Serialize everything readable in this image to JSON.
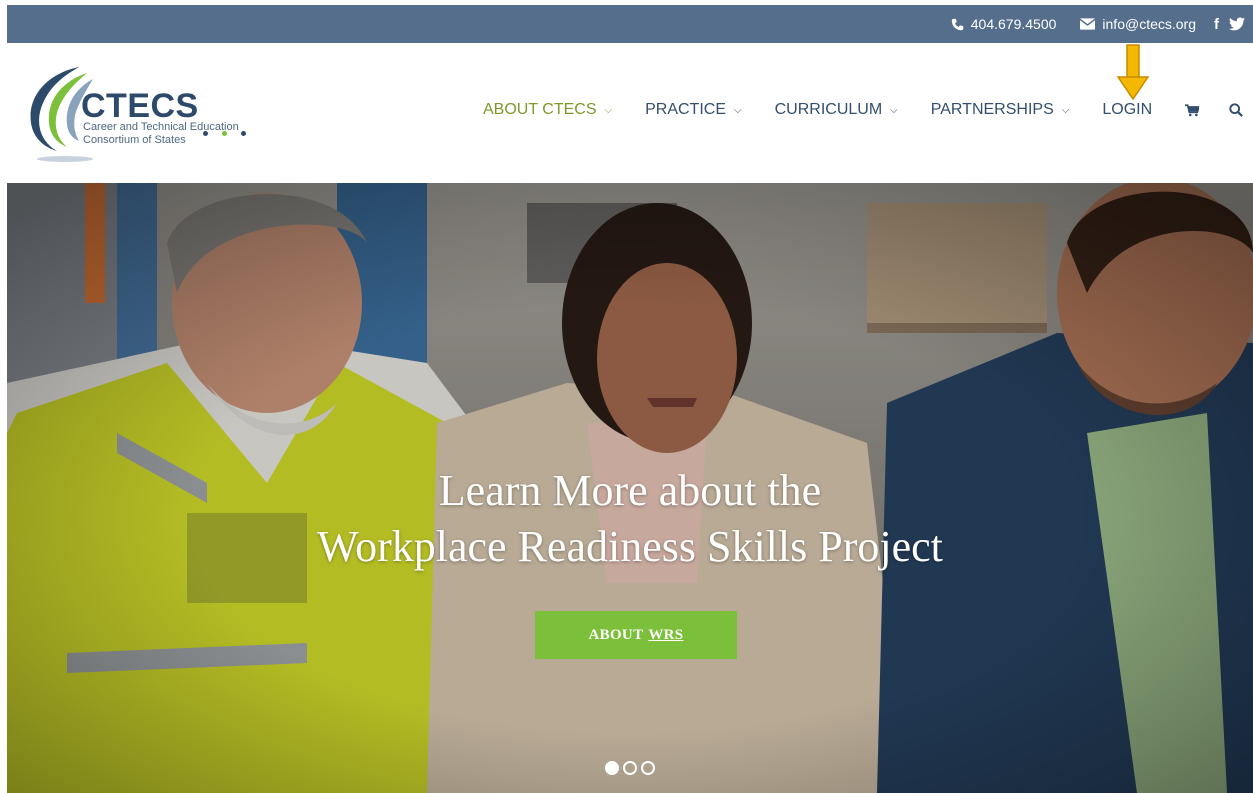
{
  "topbar": {
    "phone": "404.679.4500",
    "email": "info@ctecs.org",
    "social": [
      "facebook-icon",
      "twitter-icon"
    ]
  },
  "logo": {
    "brand": "CTECS",
    "tagline_line1": "Career and Technical Education",
    "tagline_line2": "Consortium of States",
    "dot_colors": [
      "#2e4a6b",
      "#7cbf3a",
      "#2e4a6b"
    ]
  },
  "nav": {
    "items": [
      {
        "label": "ABOUT CTECS",
        "dropdown": true,
        "active": true
      },
      {
        "label": "PRACTICE",
        "dropdown": true
      },
      {
        "label": "CURRICULUM",
        "dropdown": true
      },
      {
        "label": "PARTNERSHIPS",
        "dropdown": true
      },
      {
        "label": "LOGIN",
        "dropdown": false
      }
    ],
    "icons": [
      "cart-icon",
      "search-icon"
    ]
  },
  "hero": {
    "headline_line1": "Learn More about the",
    "headline_line2": "Workplace Readiness Skills Project",
    "cta_prefix": "ABOUT",
    "cta_underlined": "WRS",
    "slides_total": 3,
    "active_slide": 1
  },
  "colors": {
    "topbar": "#546e8c",
    "nav_text": "#334e6e",
    "nav_active": "#7a9a2a",
    "cta": "#7cbf3a",
    "annotation_arrow": "#f5b800"
  }
}
